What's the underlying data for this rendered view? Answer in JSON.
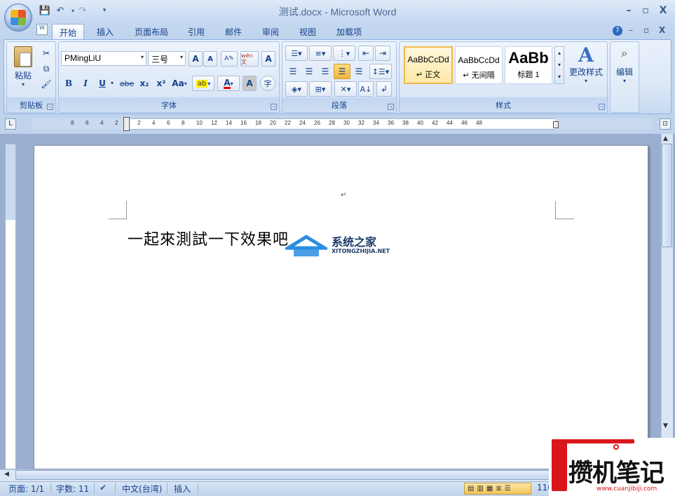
{
  "window": {
    "title": "测试.docx - Microsoft Word",
    "min_label": "–",
    "max_label": "▫",
    "close_label": "X"
  },
  "tabs": [
    "开始",
    "插入",
    "页面布局",
    "引用",
    "邮件",
    "审阅",
    "视图",
    "加载项"
  ],
  "clipboard": {
    "paste_label": "粘贴",
    "group_label": "剪贴板"
  },
  "font": {
    "name": "PMingLiU",
    "size": "三号",
    "group_label": "字体",
    "grow_label": "A",
    "shrink_label": "A",
    "wen_label": "wén 文",
    "bold": "B",
    "italic": "I",
    "underline": "U",
    "strike": "abe",
    "sub": "x₂",
    "sup": "x²",
    "case": "Aa",
    "font_color_label": "A",
    "char_shade_label": "A",
    "enclose_label": "字"
  },
  "paragraph": {
    "group_label": "段落"
  },
  "styles": {
    "group_label": "样式",
    "items": [
      {
        "preview": "AaBbCcDd",
        "name": "↵ 正文"
      },
      {
        "preview": "AaBbCcDd",
        "name": "↵ 无间隔"
      },
      {
        "preview": "AaBb",
        "name": "标题 1"
      }
    ],
    "change_label": "更改样式"
  },
  "editing": {
    "label": "编辑"
  },
  "ruler": {
    "top_numbers": [
      "8",
      "6",
      "4",
      "2",
      "2",
      "4",
      "6",
      "8",
      "10",
      "12",
      "14",
      "16",
      "18",
      "20",
      "22",
      "24",
      "26",
      "28",
      "30",
      "32",
      "34",
      "36",
      "38",
      "40",
      "42",
      "44",
      "46",
      "48"
    ]
  },
  "document": {
    "text": "一起來測試一下效果吧"
  },
  "status": {
    "page": "页面: 1/1",
    "words": "字数: 11",
    "language": "中文(台湾)",
    "insert": "插入",
    "zoom": "110"
  },
  "watermarks": {
    "site1_cn": "系统之家",
    "site1_en": "XITONGZHIJIA.NET",
    "site2_cn": "攒机笔记",
    "site2_en": "www.cuanjibiji.com"
  }
}
